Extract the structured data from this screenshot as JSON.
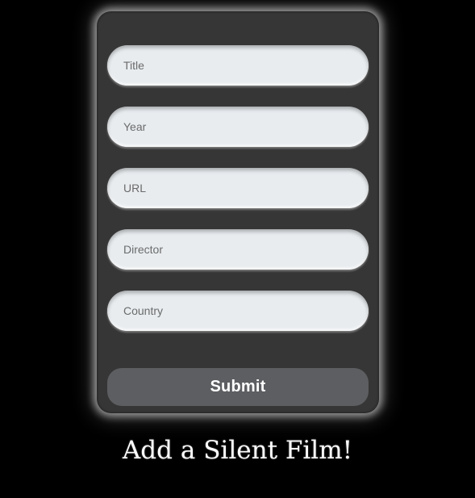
{
  "form": {
    "fields": [
      {
        "placeholder": "Title",
        "value": ""
      },
      {
        "placeholder": "Year",
        "value": ""
      },
      {
        "placeholder": "URL",
        "value": ""
      },
      {
        "placeholder": "Director",
        "value": ""
      },
      {
        "placeholder": "Country",
        "value": ""
      }
    ],
    "submit_label": "Submit"
  },
  "heading": "Add a Silent Film!",
  "colors": {
    "page_background": "#000000",
    "card_background": "#363636",
    "field_background": "#e8ecef",
    "button_background": "#5d5e61",
    "text_light": "#ffffff"
  }
}
